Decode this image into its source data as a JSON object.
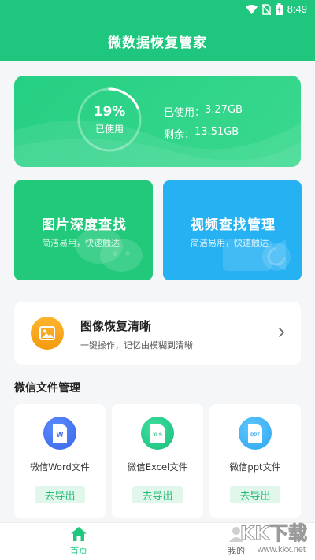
{
  "status_bar": {
    "time": "8:49"
  },
  "app": {
    "title": "微数据恢复管家"
  },
  "storage": {
    "percent_text": "19%",
    "percent_value": 0.19,
    "percent_label": "已使用",
    "used_label": "已使用：",
    "used_value": "3.27GB",
    "free_label": "剩余：",
    "free_value": "13.51GB"
  },
  "features": [
    {
      "title": "图片深度查找",
      "subtitle": "简洁易用，快速触达",
      "color": "#22c97b"
    },
    {
      "title": "视频查找管理",
      "subtitle": "简洁易用，快速触达",
      "color": "#26b1f3"
    }
  ],
  "restore": {
    "title": "图像恢复清晰",
    "subtitle": "一键操作，记忆由模糊到清晰"
  },
  "wechat_section": {
    "title": "微信文件管理",
    "files": [
      {
        "badge": "W",
        "label": "微信Word文件",
        "button": "去导出"
      },
      {
        "badge": "XLS",
        "label": "微信Excel文件",
        "button": "去导出"
      },
      {
        "badge": "PPT",
        "label": "微信ppt文件",
        "button": "去导出"
      }
    ]
  },
  "nav": {
    "home": "首页",
    "mine": "我的"
  },
  "watermark": {
    "text": "KK下载",
    "url": "www.kkx.net"
  },
  "colors": {
    "primary": "#1fc77e",
    "blue": "#26b1f3",
    "orange": "#f39a10"
  }
}
